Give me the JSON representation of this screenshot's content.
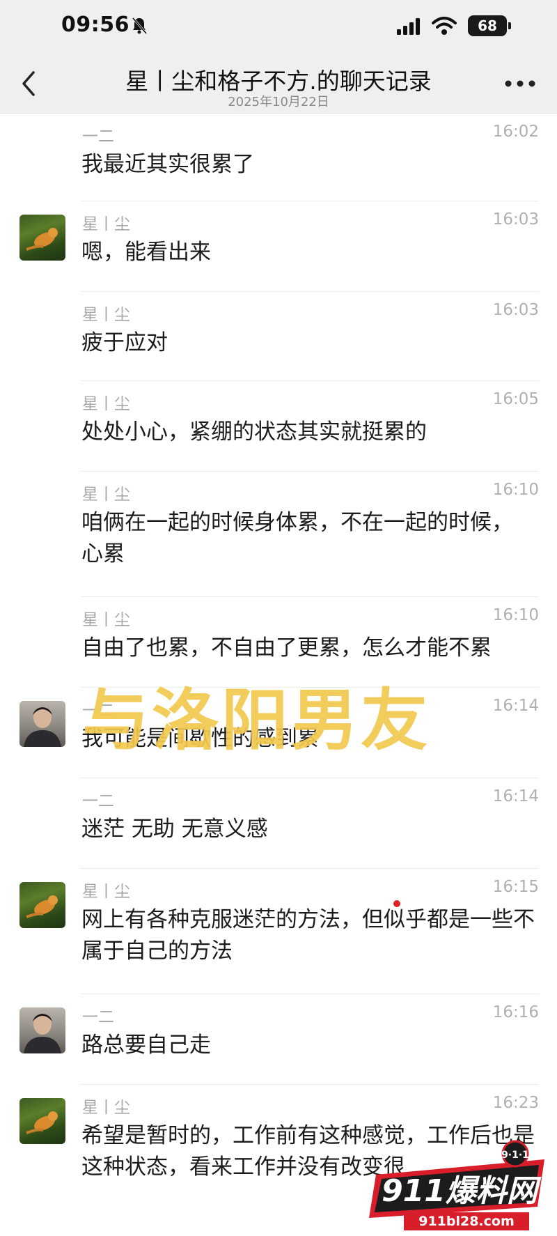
{
  "status_bar": {
    "time": "09:56",
    "battery": "68"
  },
  "nav": {
    "title": "星丨尘和格子不方.的聊天记录",
    "subtitle": "2025年10月22日"
  },
  "messages": [
    {
      "sender": "一二",
      "time": "16:02",
      "text": "我最近其实很累了",
      "avatar": "none"
    },
    {
      "sender": "星丨尘",
      "time": "16:03",
      "text": "嗯，能看出来",
      "avatar": "cat"
    },
    {
      "sender": "星丨尘",
      "time": "16:03",
      "text": "疲于应对",
      "avatar": "none"
    },
    {
      "sender": "星丨尘",
      "time": "16:05",
      "text": "处处小心，紧绷的状态其实就挺累的",
      "avatar": "none"
    },
    {
      "sender": "星丨尘",
      "time": "16:10",
      "text": "咱俩在一起的时候身体累，不在一起的时候，心累",
      "avatar": "none"
    },
    {
      "sender": "星丨尘",
      "time": "16:10",
      "text": "自由了也累，不自由了更累，怎么才能不累",
      "avatar": "none"
    },
    {
      "sender": "一二",
      "time": "16:14",
      "text": "我可能是间歇性的感到累",
      "avatar": "man"
    },
    {
      "sender": "一二",
      "time": "16:14",
      "text": "迷茫 无助 无意义感",
      "avatar": "none"
    },
    {
      "sender": "星丨尘",
      "time": "16:15",
      "text": "网上有各种克服迷茫的方法，但似乎都是一些不属于自己的方法",
      "avatar": "cat"
    },
    {
      "sender": "一二",
      "time": "16:16",
      "text": "路总要自己走",
      "avatar": "man"
    },
    {
      "sender": "星丨尘",
      "time": "16:23",
      "text": "希望是暂时的，工作前有这种感觉，工作后也是这种状态，看来工作并没有改变很",
      "avatar": "cat"
    }
  ],
  "overlay": {
    "caption": "与洛阳男友"
  },
  "logo": {
    "brand": "911爆料网",
    "badge": "9·1·1",
    "url": "911bl28.com"
  }
}
